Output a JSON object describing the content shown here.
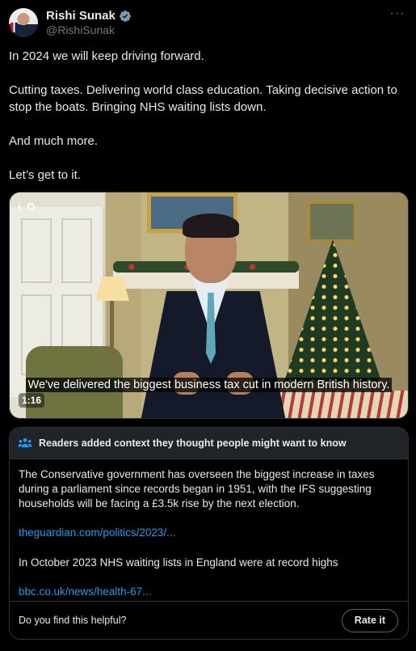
{
  "author": {
    "name": "Rishi Sunak",
    "handle": "@RishiSunak",
    "verified_icon": "verified-badge-icon",
    "more_icon": "more-options-icon",
    "more_glyph": "···"
  },
  "tweet": {
    "paragraphs": [
      "In 2024 we will keep driving forward.",
      "Cutting taxes. Delivering world class education. Taking decisive action to stop the boats. Bringing NHS waiting lists down.",
      "And much more.",
      "Let’s get to it."
    ]
  },
  "video": {
    "corner_label": "i O",
    "caption": "We've delivered the biggest business tax cut in modern British history.",
    "duration": "1:16"
  },
  "community_note": {
    "icon": "community-notes-icon",
    "header": "Readers added context they thought people might want to know",
    "paragraph1": "The Conservative government has overseen the biggest increase in taxes during a parliament since records began in 1951, with the IFS suggesting households will be facing a £3.5k rise by the next election.",
    "link1": "theguardian.com/politics/2023/...",
    "paragraph2": "In October 2023 NHS waiting lists in England were at record highs",
    "link2": "bbc.co.uk/news/health-67...",
    "question": "Do you find this helpful?",
    "rate_label": "Rate it"
  },
  "colors": {
    "background": "#000000",
    "link": "#1d9bf0",
    "verified": "#829aab",
    "secondary_text": "#71767b"
  }
}
